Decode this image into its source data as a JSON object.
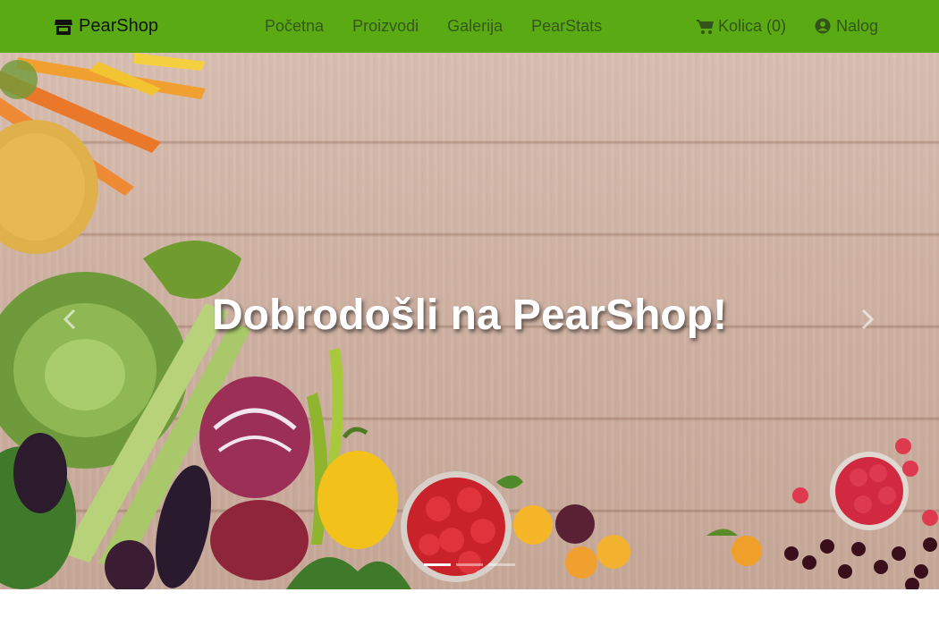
{
  "brand": {
    "name": "PearShop",
    "icon": "store-icon"
  },
  "nav": {
    "links": [
      "Početna",
      "Proizvodi",
      "Galerija",
      "PearStats"
    ],
    "cart_label": "Kolica (0)",
    "account_label": "Nalog"
  },
  "hero": {
    "caption": "Dobrodošli na PearShop!",
    "prev_icon": "chevron-left-icon",
    "next_icon": "chevron-right-icon",
    "slide_count": 3,
    "active_slide": 1
  },
  "colors": {
    "navbar": "#5aaa14",
    "nav_text": "#2f4a1a"
  }
}
